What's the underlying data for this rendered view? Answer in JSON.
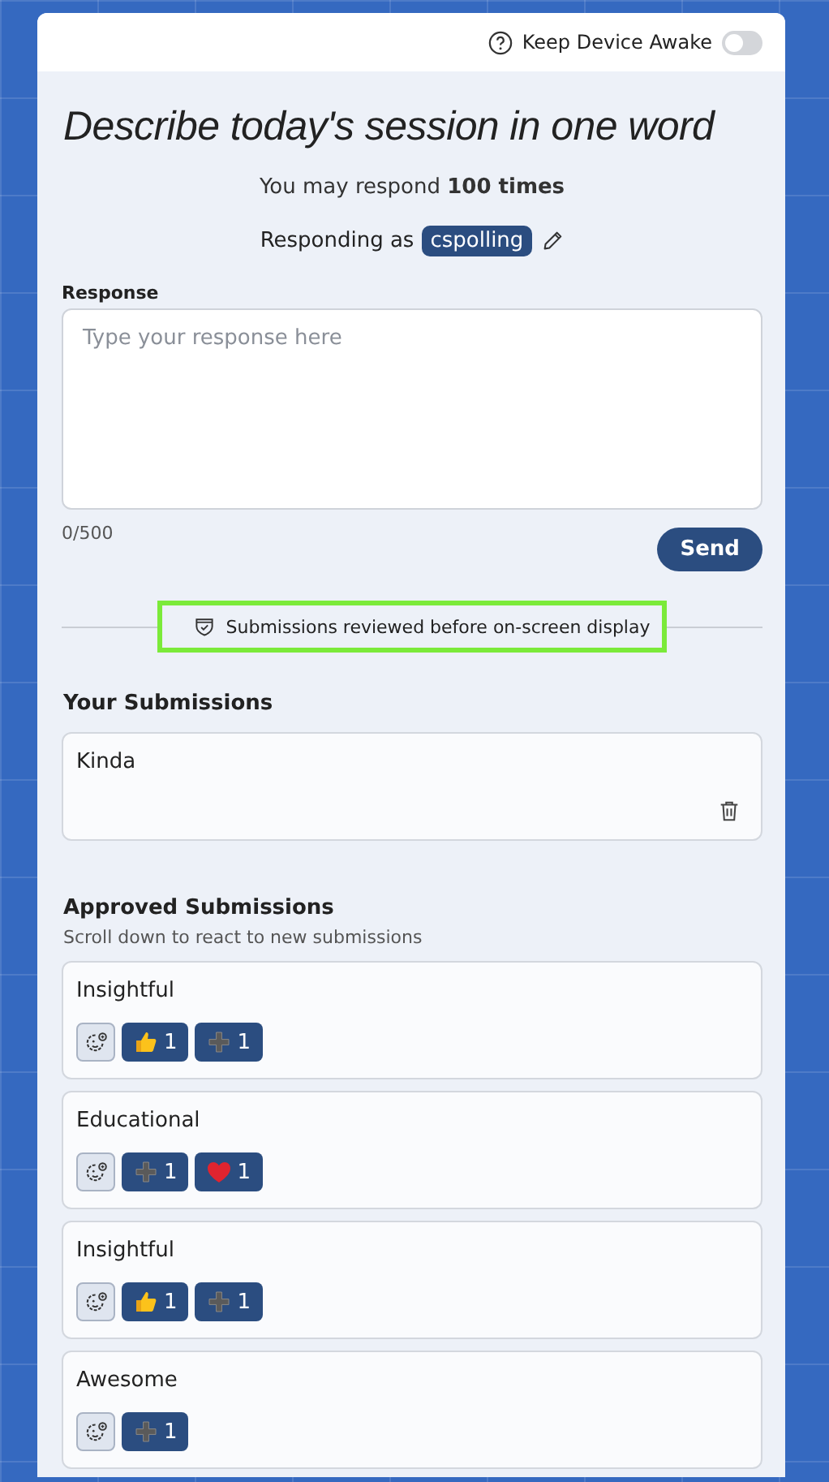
{
  "header": {
    "label": "Keep Device Awake",
    "on": false
  },
  "title": "Describe today's session in one word",
  "limit": "You may respond **100 times**",
  "responding": {
    "label": "Responding as",
    "name": "cspolling"
  },
  "response": {
    "label": "Response",
    "placeholder": "Type your response here",
    "counter": "0/500",
    "button": "Send"
  },
  "notice": {
    "text": "Submissions reviewed before on-screen display",
    "highlighted": true
  },
  "your_submissions": {
    "heading": "Your Submissions",
    "items": [
      {
        "text": "Kinda"
      }
    ]
  },
  "approved": {
    "heading": "Approved Submissions",
    "hint": "Scroll down to react to new submissions",
    "items": [
      {
        "text": "Insightful",
        "reactions": [
          {
            "kind": "thumbs",
            "count": "1"
          },
          {
            "kind": "plus",
            "count": "1"
          }
        ]
      },
      {
        "text": "Educational",
        "reactions": [
          {
            "kind": "plus",
            "count": "1"
          },
          {
            "kind": "heart",
            "count": "1"
          }
        ]
      },
      {
        "text": "Insightful",
        "reactions": [
          {
            "kind": "thumbs",
            "count": "1"
          },
          {
            "kind": "plus",
            "count": "1"
          }
        ]
      },
      {
        "text": "Awesome",
        "reactions": [
          {
            "kind": "plus",
            "count": "1"
          }
        ]
      }
    ]
  }
}
